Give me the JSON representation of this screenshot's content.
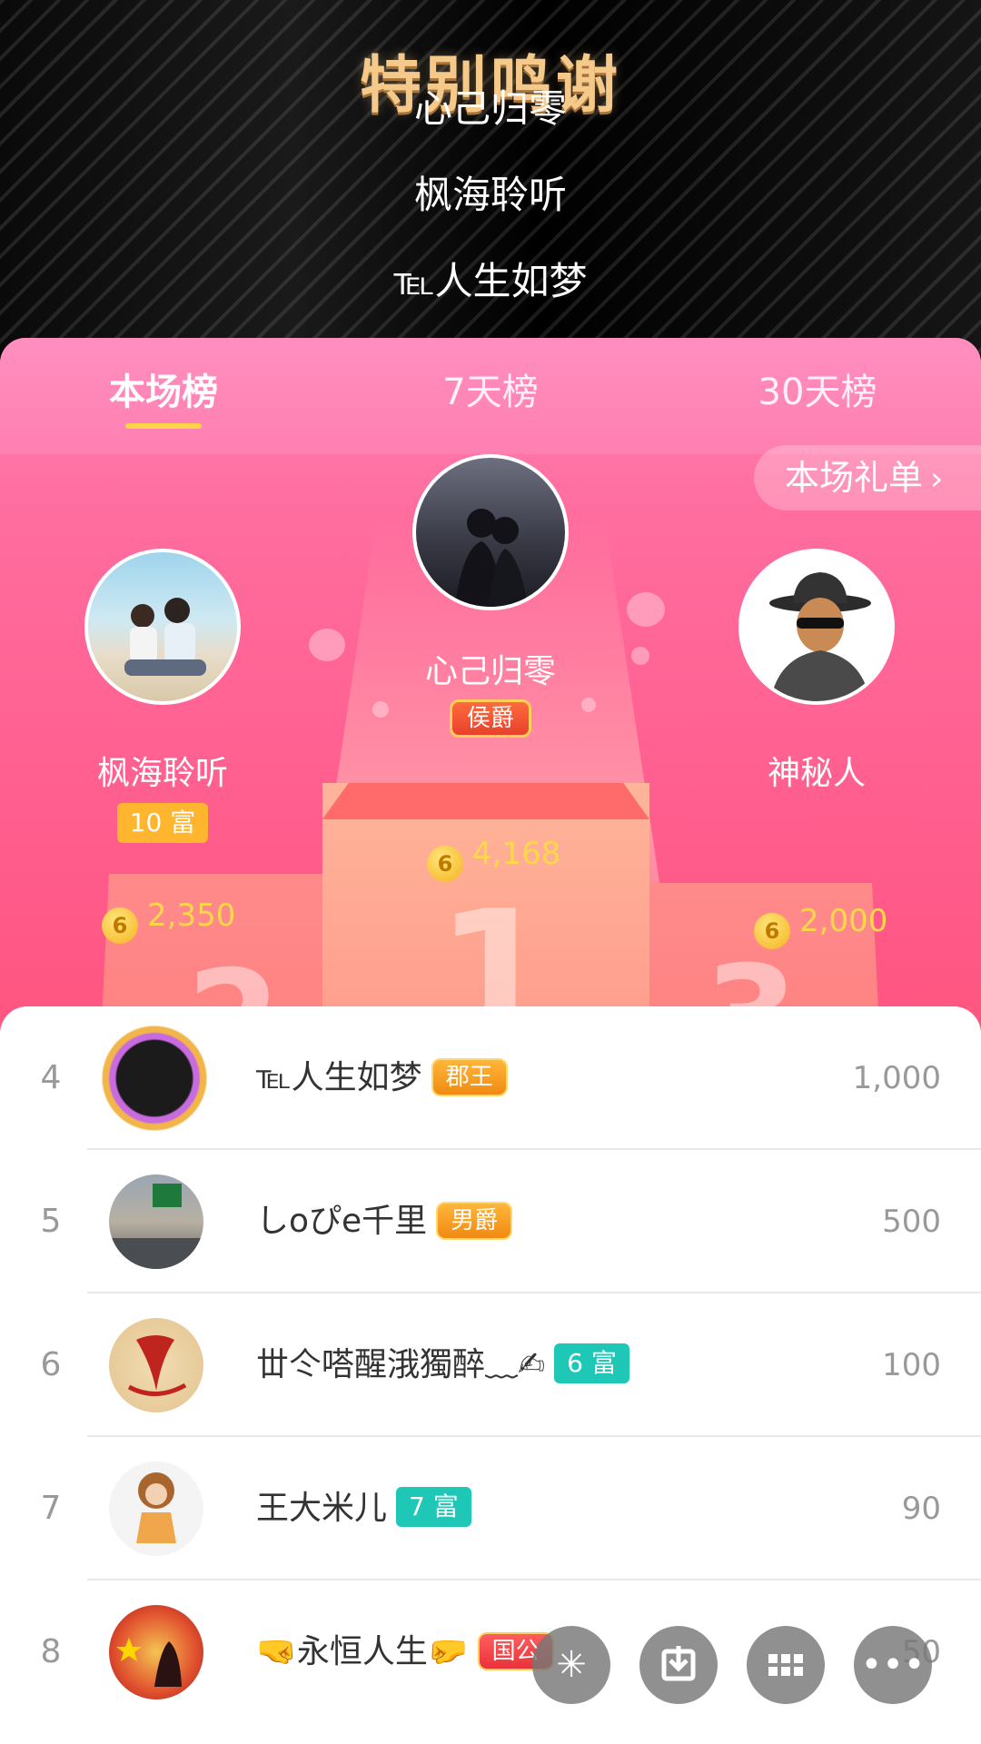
{
  "credits": {
    "title": "特别鸣谢",
    "names": [
      "心己归零",
      "枫海聆听",
      "℡人生如梦"
    ]
  },
  "tabs": [
    {
      "label": "本场榜",
      "active": true
    },
    {
      "label": "7天榜",
      "active": false
    },
    {
      "label": "30天榜",
      "active": false
    }
  ],
  "gift_list_button": "本场礼单",
  "podium": {
    "first": {
      "name": "心己归零",
      "badge": "侯爵",
      "coins": "4,168",
      "rank_mark": "1"
    },
    "second": {
      "name": "枫海聆听",
      "badge": "10 富",
      "coins": "2,350",
      "rank_mark": "2"
    },
    "third": {
      "name": "神秘人",
      "coins": "2,000",
      "rank_mark": "3"
    }
  },
  "coin_glyph": "6",
  "ranking": [
    {
      "rank": "4",
      "name": "℡人生如梦",
      "badge": "郡王",
      "score": "1,000"
    },
    {
      "rank": "5",
      "name": "しoぴe千里",
      "badge": "男爵",
      "score": "500"
    },
    {
      "rank": "6",
      "name": "丗仒嗒醒涐獨醉﹏✍",
      "badge": "6 富",
      "score": "100"
    },
    {
      "rank": "7",
      "name": "王大米儿",
      "badge": "7 富",
      "score": "90"
    },
    {
      "rank": "8",
      "name": "🤜永恒人生🤛",
      "badge": "国公",
      "score": "50"
    }
  ],
  "colors": {
    "accent_gold": "#ffd84a",
    "tab_underline": "#ffd24a",
    "teal_badge": "#1fc7b6",
    "pink_header": "#ff7fb1"
  },
  "fabs": [
    "sparkle-icon",
    "download-icon",
    "grid-icon",
    "more-icon"
  ]
}
